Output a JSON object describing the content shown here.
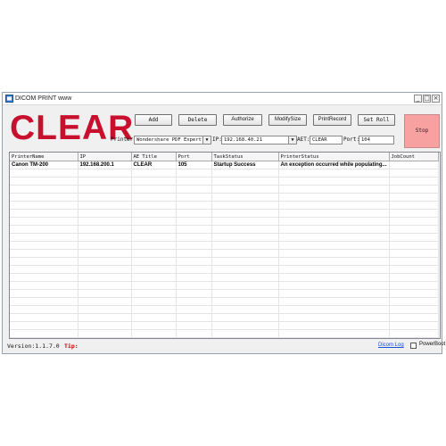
{
  "window": {
    "title": "DICOM PRINT www",
    "controls": {
      "minimize": "_",
      "maximize": "□",
      "close": "×"
    }
  },
  "logo": {
    "text": "CLEAR",
    "color": "#c8102e"
  },
  "toolbar": {
    "add": "Add",
    "delete": "Delete",
    "authorize": "Authorize",
    "modify_size": "ModifySize",
    "print_record": "PrintRecord",
    "set_roll": "Set Roll",
    "stop": "Stop"
  },
  "config": {
    "printer_label": "Printer:",
    "printer_value": "Wondershare PDF Expert",
    "ip_label": "IP:",
    "ip_value": "192.168.40.21",
    "aet_label": "AET:",
    "aet_value": "CLEAR",
    "port_label": "Port:",
    "port_value": "104"
  },
  "table": {
    "columns": [
      "PrinterName",
      "IP",
      "AE Title",
      "Port",
      "TaskStatus",
      "PrinterStatus",
      "JobCount"
    ],
    "rows": [
      [
        "Canon TM-200",
        "192.168.200.1",
        "CLEAR",
        "105",
        "Startup Success",
        "An exception occurred while populating...",
        ""
      ]
    ]
  },
  "status": {
    "version": "Version:1.1.7.0",
    "tip_label": "Tip:",
    "dicom_log": "Dicom Log",
    "powerboot": "PowerBoot"
  },
  "colors": {
    "stop_button": "#f7a1a1",
    "tip": "#c00000",
    "link": "#1a4fd6"
  },
  "icons": {
    "app": "app-icon",
    "dropdown": "chevron-down-icon",
    "checkbox": "checkbox-icon"
  }
}
